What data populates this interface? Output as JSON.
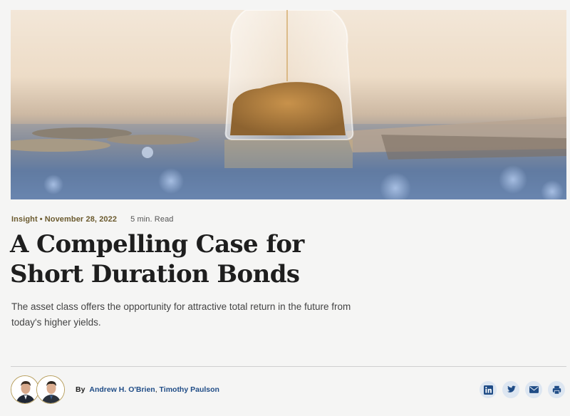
{
  "article": {
    "category": "Insight",
    "separator": "•",
    "date": "November 28, 2022",
    "read_time": "5 min. Read",
    "title": "A Compelling Case for Short Duration Bonds",
    "dek": "The asset class offers the opportunity for attractive total return in the future from today's higher yields."
  },
  "byline": {
    "prefix": "By",
    "authors": [
      "Andrew H. O'Brien",
      "Timothy Paulson"
    ],
    "joiner": ","
  },
  "hero": {
    "icon": "hourglass-coins-image"
  },
  "share": {
    "icons": [
      "linkedin-icon",
      "twitter-icon",
      "email-icon",
      "print-icon"
    ],
    "icon_color": "#1f4c86",
    "bg_color": "#dde6f1"
  },
  "colors": {
    "meta": "#6b5a2e",
    "link": "#1f4c86",
    "avatar_border": "#b79e5c"
  }
}
